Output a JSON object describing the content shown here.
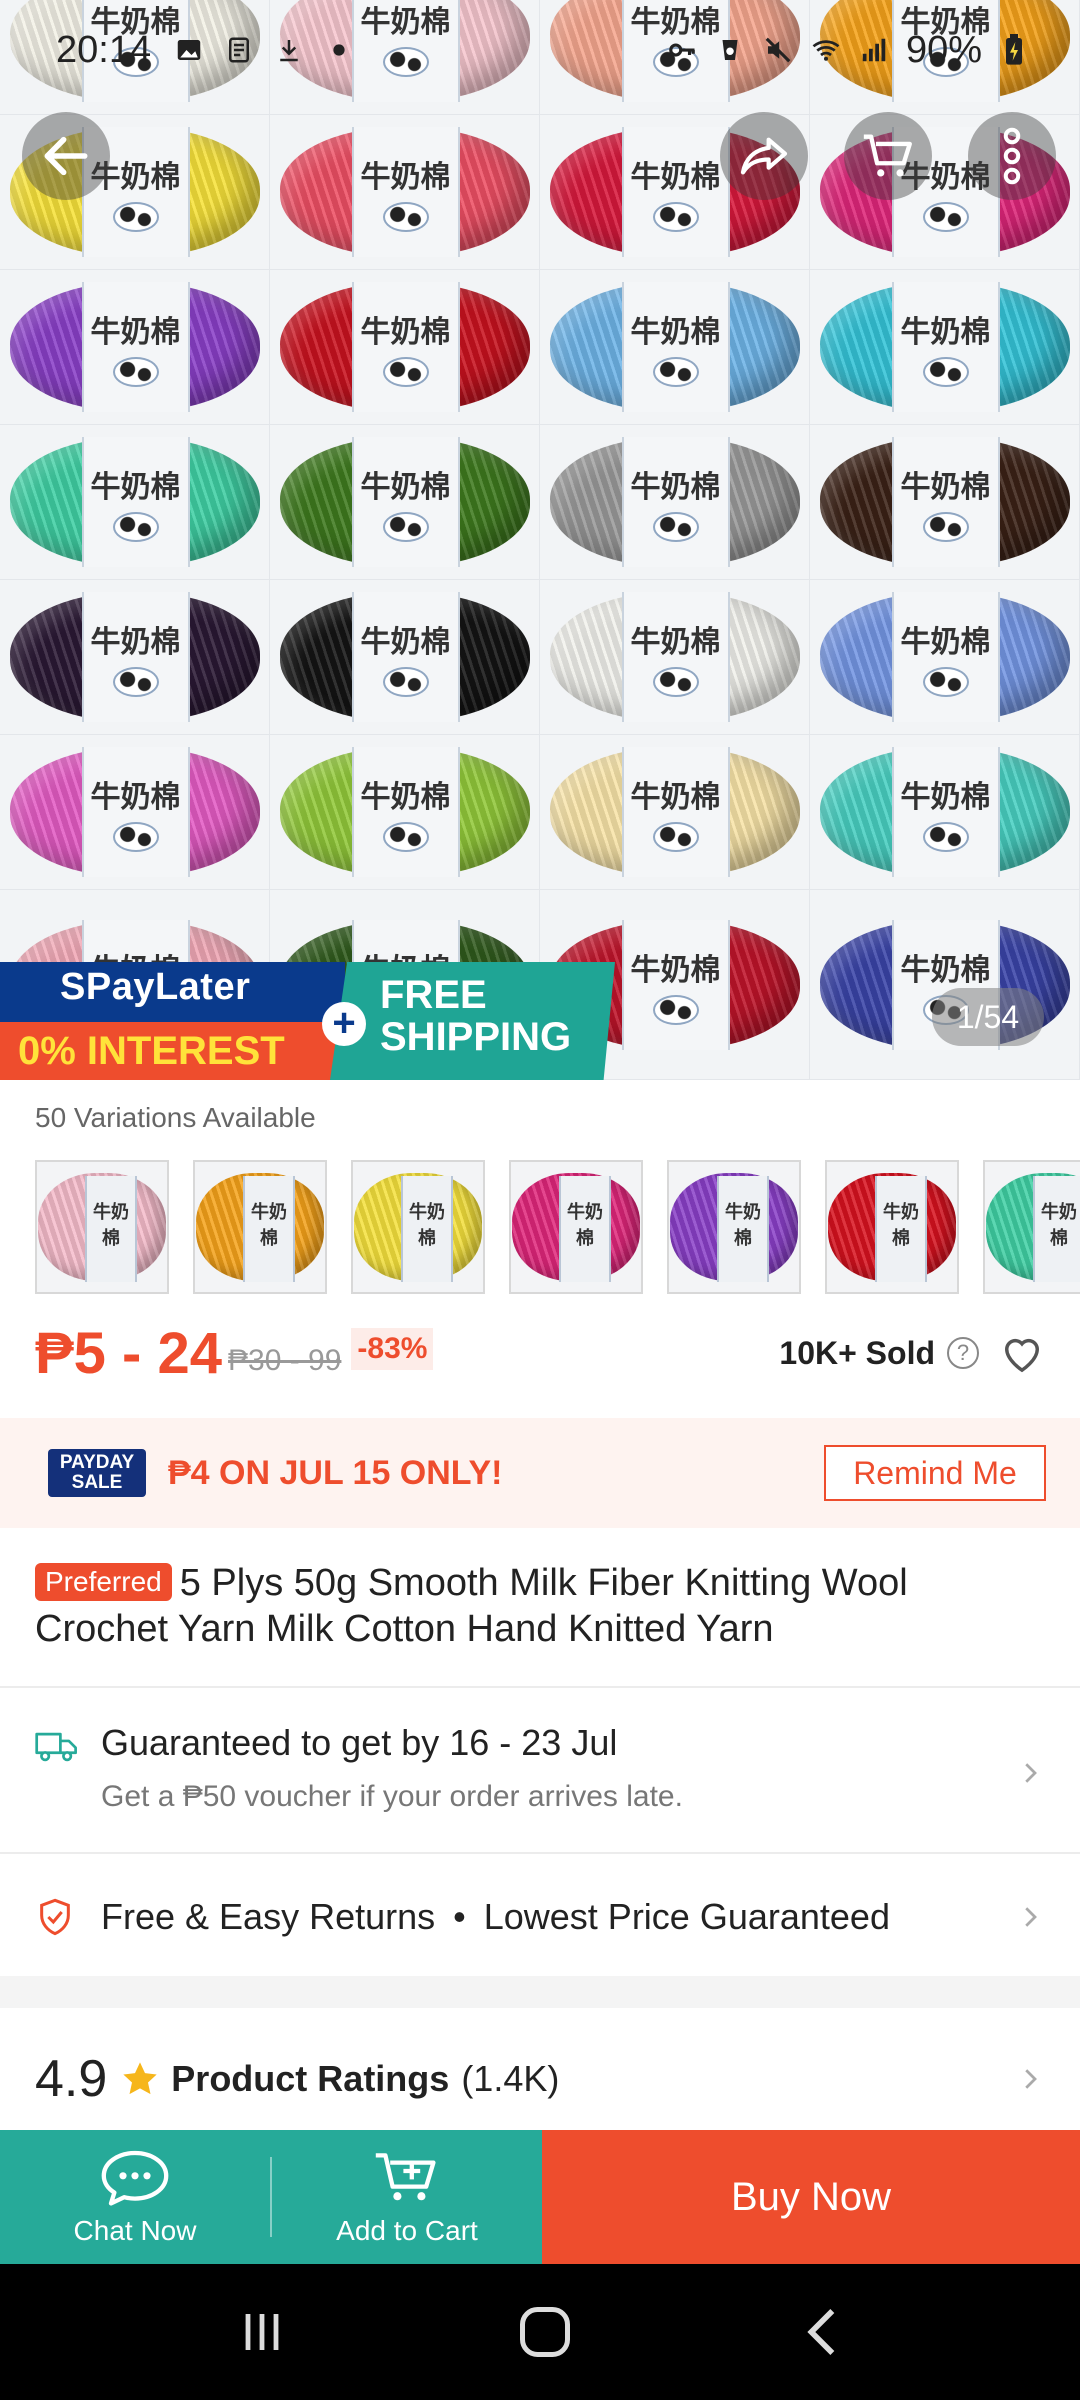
{
  "status_bar": {
    "time": "20:14",
    "battery": "90%"
  },
  "hero": {
    "brand_text": "牛奶棉",
    "yarn_colors": [
      "#f3f1e6",
      "#f7c7cf",
      "#f6a78f",
      "#f6a31a",
      "#f7e23a",
      "#ee4f64",
      "#d8183c",
      "#e0267a",
      "#8a3fc8",
      "#c9121f",
      "#6eb4e8",
      "#34c4d8",
      "#3fd0a4",
      "#3e7a1e",
      "#9a9a9a",
      "#3b2116",
      "#2a1834",
      "#141414",
      "#f1f1ec",
      "#7496e4",
      "#e45bc4",
      "#92c93a",
      "#f8e4a8",
      "#48d0c2",
      "#f1a8b6",
      "#2f5a1c",
      "#c0142a",
      "#3a44a8"
    ],
    "promo": {
      "paylater_title": "SPayLater",
      "interest_text": "0% INTEREST",
      "free_shipping": "FREE SHIPPING",
      "plus_symbol": "+"
    },
    "image_counter": "1/54"
  },
  "variations": {
    "label": "50 Variations Available",
    "thumbs": [
      {
        "color": "#f6bccb",
        "tag": "牛奶棉"
      },
      {
        "color": "#f6a31a",
        "tag": "牛奶棉"
      },
      {
        "color": "#f5e13c",
        "tag": "牛奶棉"
      },
      {
        "color": "#e0267a",
        "tag": "牛奶棉"
      },
      {
        "color": "#8a3fc8",
        "tag": "牛奶棉"
      },
      {
        "color": "#d8121f",
        "tag": "牛奶棉"
      },
      {
        "color": "#3fd0a4",
        "tag": "牛奶棉"
      }
    ]
  },
  "price": {
    "range": "₱5 - 24",
    "original": "₱30 - 99",
    "discount": "-83%",
    "sold": "10K+ Sold",
    "help_symbol": "?"
  },
  "payday": {
    "logo": "PAYDAY SALE",
    "text": "₱4 ON JUL 15 ONLY!",
    "remind_button": "Remind Me"
  },
  "product": {
    "badge": "Preferred",
    "title": "5 Plys 50g Smooth Milk Fiber Knitting Wool Crochet Yarn Milk Cotton Hand Knitted Yarn"
  },
  "shipping": {
    "main": "Guaranteed to get by 16 - 23 Jul",
    "sub": "Get a ₱50 voucher if your order arrives late."
  },
  "returns": {
    "left": "Free & Easy Returns",
    "separator": "•",
    "right": "Lowest Price Guaranteed"
  },
  "ratings": {
    "score": "4.9",
    "label": "Product Ratings",
    "count": "(1.4K)"
  },
  "actions": {
    "chat": "Chat Now",
    "add_to_cart": "Add to Cart",
    "buy_now": "Buy Now"
  },
  "colors": {
    "accent": "#ee4d2d",
    "teal": "#26aa99"
  }
}
